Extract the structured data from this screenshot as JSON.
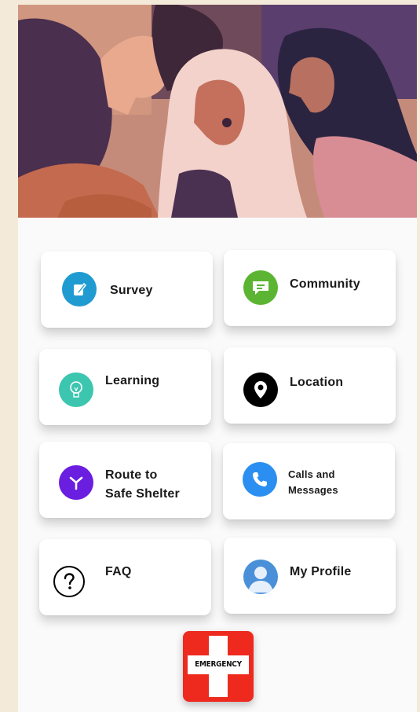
{
  "hero": {
    "icon": "women-illustration"
  },
  "menu": [
    {
      "id": "survey",
      "label": "Survey",
      "icon": "edit-icon",
      "color": "#1f9bd1"
    },
    {
      "id": "community",
      "label": "Community",
      "icon": "chat-icon",
      "color": "#5cb532"
    },
    {
      "id": "learning",
      "label": "Learning",
      "icon": "lightbulb-icon",
      "color": "#3cc6b0"
    },
    {
      "id": "location",
      "label": "Location",
      "icon": "location-pin-icon",
      "color": "#000000"
    },
    {
      "id": "route",
      "label_line1": "Route to",
      "label_line2": "Safe Shelter",
      "icon": "route-icon",
      "color": "#6a1ee0"
    },
    {
      "id": "calls",
      "label_line1": "Calls and",
      "label_line2": "Messages",
      "icon": "phone-icon",
      "color": "#2a8ff0"
    },
    {
      "id": "faq",
      "label": "FAQ",
      "icon": "question-icon",
      "color": "#000000"
    },
    {
      "id": "profile",
      "label": "My Profile",
      "icon": "user-icon",
      "color": "#4a90d9"
    }
  ],
  "emergency": {
    "label": "EMERGENCY",
    "color": "#ee2a1e"
  }
}
